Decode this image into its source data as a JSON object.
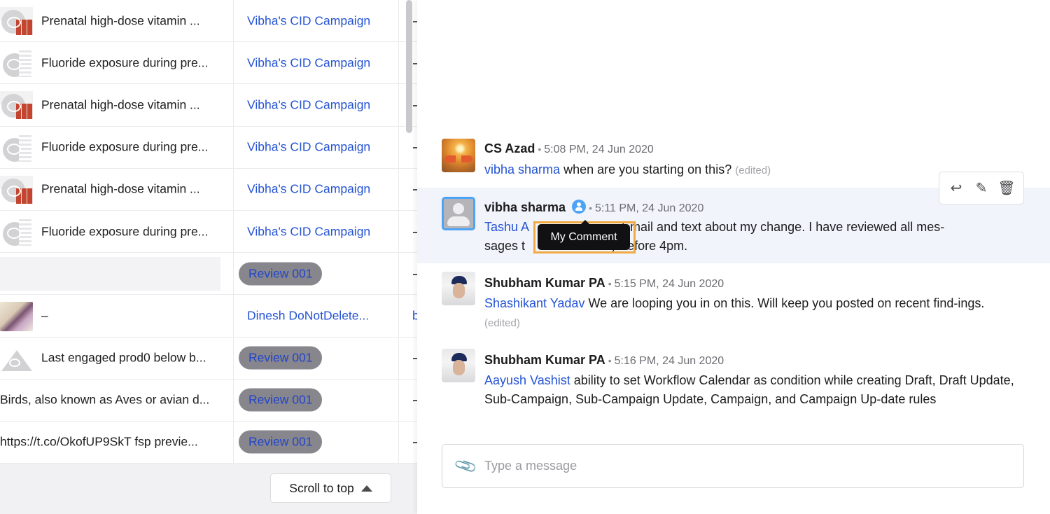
{
  "table": {
    "rows": [
      {
        "thumb": "vitamin",
        "title": "Prenatal high-dose vitamin ...",
        "campaign": "Vibha's CID Campaign",
        "campaign_type": "link",
        "col3": "-"
      },
      {
        "thumb": "fluoride",
        "title": "Fluoride exposure during pre...",
        "campaign": "Vibha's CID Campaign",
        "campaign_type": "link",
        "col3": "-"
      },
      {
        "thumb": "vitamin",
        "title": "Prenatal high-dose vitamin ...",
        "campaign": "Vibha's CID Campaign",
        "campaign_type": "link",
        "col3": "-"
      },
      {
        "thumb": "fluoride",
        "title": "Fluoride exposure during pre...",
        "campaign": "Vibha's CID Campaign",
        "campaign_type": "link",
        "col3": "-"
      },
      {
        "thumb": "vitamin",
        "title": "Prenatal high-dose vitamin ...",
        "campaign": "Vibha's CID Campaign",
        "campaign_type": "link",
        "col3": "-"
      },
      {
        "thumb": "fluoride",
        "title": "Fluoride exposure during pre...",
        "campaign": "Vibha's CID Campaign",
        "campaign_type": "link",
        "col3": "-"
      },
      {
        "thumb": "skeleton",
        "title": "",
        "campaign": "Review 001",
        "campaign_type": "badge",
        "col3": "-"
      },
      {
        "thumb": "yoga",
        "title": "–",
        "campaign": "Dinesh DoNotDelete...",
        "campaign_type": "link",
        "col3": "b"
      },
      {
        "thumb": "triangle",
        "title": "Last engaged prod0 below b...",
        "campaign": "Review 001",
        "campaign_type": "badge",
        "col3": "-"
      },
      {
        "thumb": "none",
        "title": "Birds, also known as Aves or avian d...",
        "campaign": "Review 001",
        "campaign_type": "badge",
        "col3": "-"
      },
      {
        "thumb": "none",
        "title": "https://t.co/OkofUP9SkT fsp previe...",
        "campaign": "Review 001",
        "campaign_type": "badge",
        "col3": "-"
      }
    ],
    "scroll_to_top_label": "Scroll to top"
  },
  "comments": [
    {
      "author": "CS Azad",
      "time": "5:08 PM, 24 Jun 2020",
      "mention": "vibha sharma",
      "text": " when are you starting on this?",
      "edited": "(edited)"
    },
    {
      "author": "vibha sharma",
      "time": "5:11 PM, 24 Jun 2020",
      "mention": "Tashu A",
      "text_hidden_part": "",
      "text_visible_after_tooltip": "Email and text about my change. I have reviewed all mes-",
      "line2_start": "sages t",
      "line2_end": "y before 4pm.",
      "is_mine": true
    },
    {
      "author": "Shubham Kumar PA",
      "time": "5:15 PM, 24 Jun 2020",
      "mention": "Shashikant Yadav",
      "text": " We are looping you in on this. Will keep you posted on recent find-ings.",
      "edited": "(edited)"
    },
    {
      "author": "Shubham Kumar PA",
      "time": "5:16 PM, 24 Jun 2020",
      "mention": "Aayush Vashist",
      "text": " ability to set Workflow Calendar as condition while creating Draft, Draft Update, Sub-Campaign, Sub-Campaign Update, Campaign, and Campaign Up-date rules"
    }
  ],
  "tooltip": {
    "label": "My Comment"
  },
  "actions": {
    "reply": "↩",
    "edit": "✎",
    "delete": "🗑"
  },
  "composer": {
    "placeholder": "Type a message",
    "value": ""
  },
  "colors": {
    "link": "#2453d4",
    "highlight": "#f1f4fb",
    "tooltip_outline": "#f0a943",
    "badge_bg": "#86868c"
  }
}
